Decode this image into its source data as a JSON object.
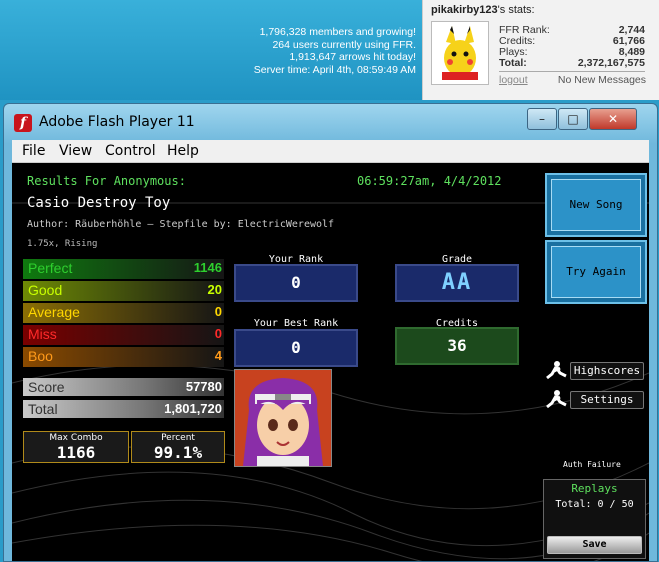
{
  "site": {
    "stats": [
      "1,796,328 members and growing!",
      "264 users currently using FFR.",
      "1,913,647 arrows hit today!",
      "Server time: April 4th, 08:59:49 AM"
    ],
    "user": {
      "name": "pikakirby123",
      "suffix": "'s stats:",
      "rank_label": "FFR Rank:",
      "rank": "2,744",
      "credits_label": "Credits:",
      "credits": "61,766",
      "plays_label": "Plays:",
      "plays": "8,489",
      "total_label": "Total:",
      "total": "2,372,167,575",
      "logout": "logout",
      "messages": "No New Messages"
    }
  },
  "window": {
    "title": "Adobe Flash Player 11",
    "menu": [
      "File",
      "View",
      "Control",
      "Help"
    ],
    "min": "–",
    "max": "□",
    "close": "✕"
  },
  "results": {
    "heading": "Results For Anonymous:",
    "datetime": "06:59:27am, 4/4/2012",
    "song": "Casio Destroy Toy",
    "author": "Author: Räuberhöhle  –  Stepfile by: ElectricWerewolf",
    "speed": "1.75x, Rising",
    "judges": [
      {
        "label": "Perfect",
        "value": "1146",
        "color": "#2ecf2e",
        "bg": "#0f7a0f"
      },
      {
        "label": "Good",
        "value": "20",
        "color": "#c8ff00",
        "bg": "#6e8a05"
      },
      {
        "label": "Average",
        "value": "0",
        "color": "#ffd700",
        "bg": "#8a6e05"
      },
      {
        "label": "Miss",
        "value": "0",
        "color": "#ff2a2a",
        "bg": "#7a0000"
      },
      {
        "label": "Boo",
        "value": "4",
        "color": "#ff9a1a",
        "bg": "#8a4a00"
      }
    ],
    "score_label": "Score",
    "score": "57780",
    "total_label": "Total",
    "total": "1,801,720",
    "max_combo_label": "Max Combo",
    "max_combo": "1166",
    "percent_label": "Percent",
    "percent": "99.1%",
    "your_rank_label": "Your Rank",
    "your_rank": "0",
    "best_rank_label": "Your Best Rank",
    "best_rank": "0",
    "grade_label": "Grade",
    "grade": "AA",
    "credits_label": "Credits",
    "credits": "36"
  },
  "side": {
    "new_song": "New Song",
    "try_again": "Try Again",
    "highscores": "Highscores",
    "settings": "Settings",
    "auth": "Auth Failure",
    "replays_label": "Replays",
    "replays_count": "Total: 0 / 50",
    "save": "Save"
  }
}
